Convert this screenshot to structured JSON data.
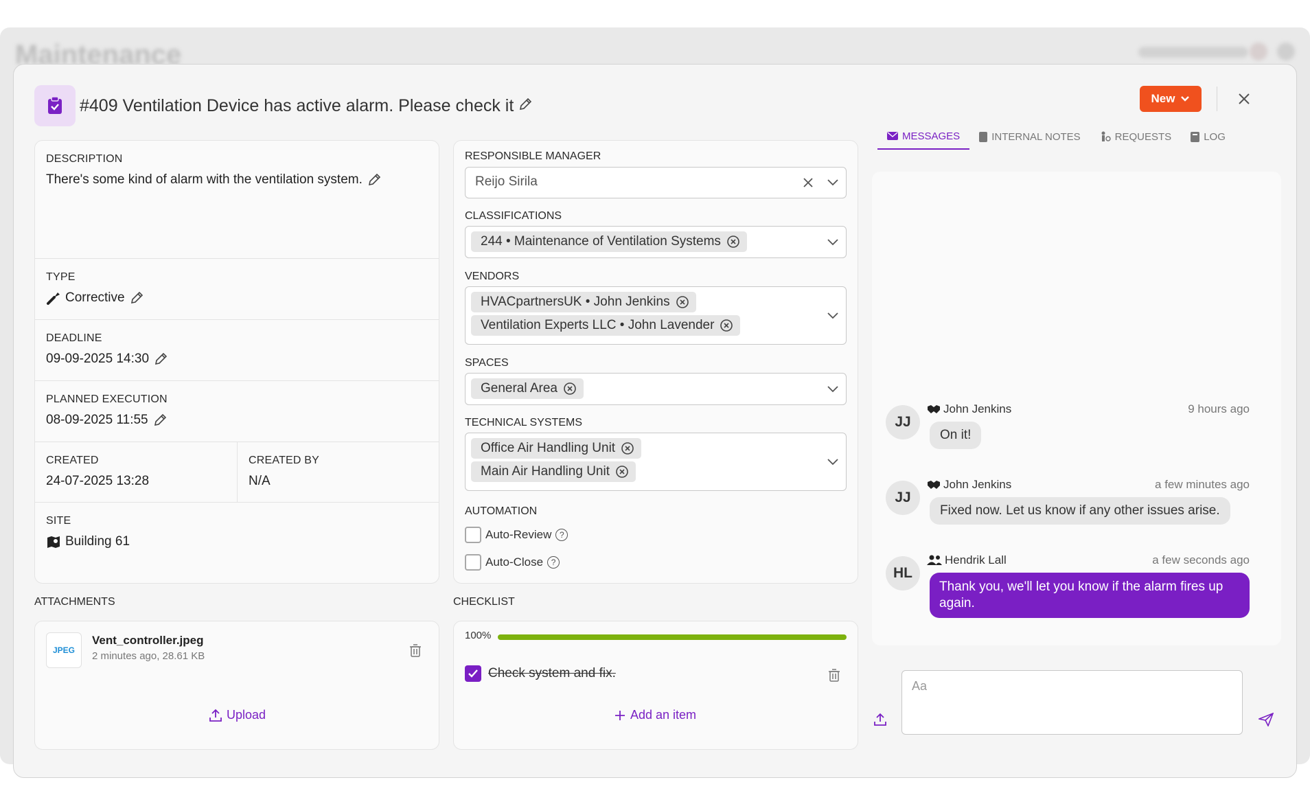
{
  "modal": {
    "title": "#409 Ventilation Device has active alarm. Please check it",
    "status": "New"
  },
  "details": {
    "description_label": "DESCRIPTION",
    "description": "There's some kind of alarm with the ventilation system.",
    "type_label": "TYPE",
    "type": "Corrective",
    "deadline_label": "DEADLINE",
    "deadline": "09-09-2025 14:30",
    "planned_label": "PLANNED EXECUTION",
    "planned": "08-09-2025 11:55",
    "created_label": "CREATED",
    "created": "24-07-2025 13:28",
    "created_by_label": "CREATED BY",
    "created_by": "N/A",
    "site_label": "SITE",
    "site": "Building 61"
  },
  "fields": {
    "manager_label": "RESPONSIBLE MANAGER",
    "manager": "Reijo Sirila",
    "classifications_label": "CLASSIFICATIONS",
    "classifications": [
      "244 • Maintenance of Ventilation Systems"
    ],
    "vendors_label": "VENDORS",
    "vendors": [
      "HVACpartnersUK • John Jenkins",
      "Ventilation Experts LLC • John Lavender"
    ],
    "spaces_label": "SPACES",
    "spaces": [
      "General Area"
    ],
    "systems_label": "TECHNICAL SYSTEMS",
    "systems": [
      "Office Air Handling Unit",
      "Main Air Handling Unit"
    ],
    "automation_label": "AUTOMATION",
    "auto_review": "Auto-Review",
    "auto_close": "Auto-Close"
  },
  "attachments": {
    "label": "ATTACHMENTS",
    "file_badge": "JPEG",
    "file_name": "Vent_controller.jpeg",
    "file_meta": "2 minutes ago, 28.61 KB",
    "upload_label": "Upload"
  },
  "checklist": {
    "label": "CHECKLIST",
    "progress_text": "100%",
    "progress": 1.0,
    "item": "Check system and fix.",
    "item_checked": true,
    "add_label": "Add an item"
  },
  "tabs": [
    "MESSAGES",
    "INTERNAL NOTES",
    "REQUESTS",
    "LOG"
  ],
  "messages": [
    {
      "initials": "JJ",
      "author": "John Jenkins",
      "time": "9 hours ago",
      "text": "On it!",
      "mine": false
    },
    {
      "initials": "JJ",
      "author": "John Jenkins",
      "time": "a few minutes ago",
      "text": "Fixed now. Let us know if any other issues arise.",
      "mine": false
    },
    {
      "initials": "HL",
      "author": "Hendrik Lall",
      "time": "a few seconds ago",
      "text": "Thank you, we'll let you know if the alarm fires up again.",
      "mine": true
    }
  ],
  "composer": {
    "placeholder": "Aa"
  },
  "colors": {
    "accent": "#7a21c4",
    "status": "#f0511e",
    "progress": "#7db20e"
  }
}
